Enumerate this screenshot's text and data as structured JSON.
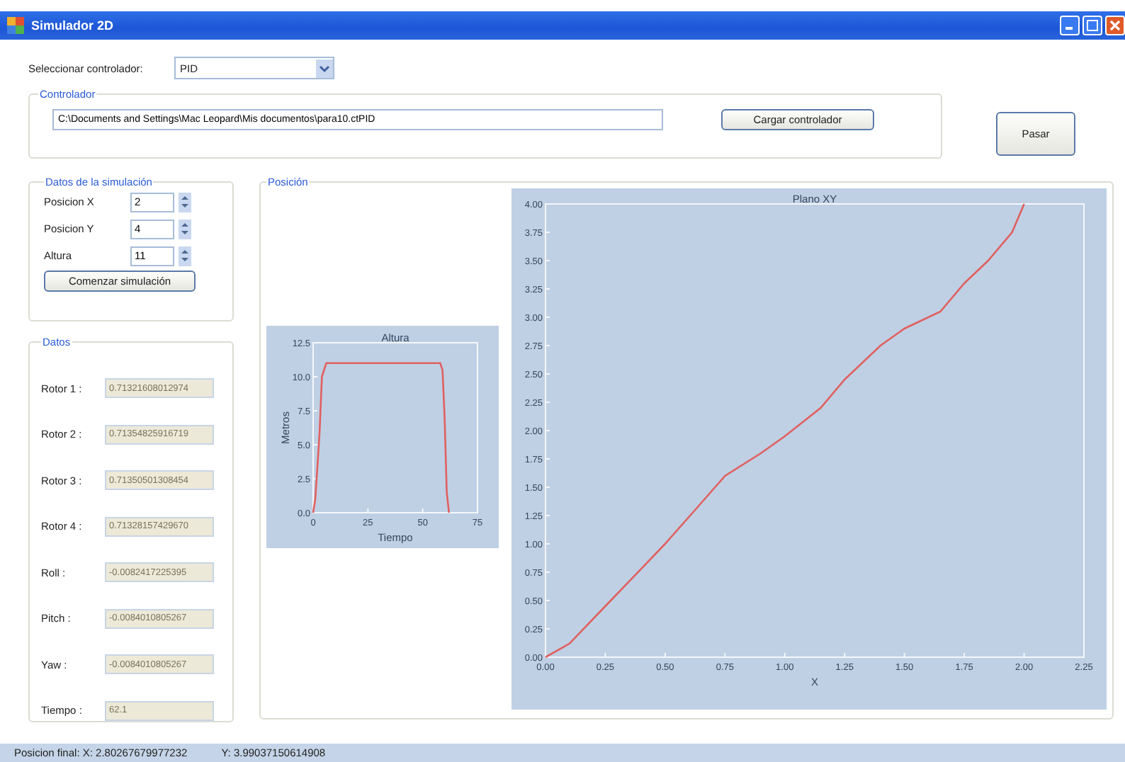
{
  "window": {
    "title": "Simulador 2D"
  },
  "controller_select": {
    "label": "Seleccionar controlador:",
    "value": "PID"
  },
  "controller_group": {
    "title": "Controlador",
    "path": "C:\\Documents and Settings\\Mac Leopard\\Mis documentos\\para10.ctPID",
    "load_button": "Cargar controlador"
  },
  "pasar_button": "Pasar",
  "simulation_group": {
    "title": "Datos de la simulación",
    "fields": [
      {
        "label": "Posicion X",
        "value": "2"
      },
      {
        "label": "Posicion Y",
        "value": "4"
      },
      {
        "label": "Altura",
        "value": "11"
      }
    ],
    "start_button": "Comenzar simulación"
  },
  "data_group": {
    "title": "Datos",
    "fields": [
      {
        "label": "Rotor 1 :",
        "value": "0.71321608012974",
        "disabled": true
      },
      {
        "label": "Rotor 2 :",
        "value": "0.71354825916719",
        "disabled": true
      },
      {
        "label": "Rotor 3 :",
        "value": "0.71350501308454",
        "disabled": true
      },
      {
        "label": "Rotor 4 :",
        "value": "0.71328157429670",
        "disabled": true
      },
      {
        "label": "Roll :",
        "value": "-0.0082417225395",
        "disabled": true
      },
      {
        "label": "Pitch :",
        "value": "-0.0084010805267",
        "disabled": true
      },
      {
        "label": "Yaw :",
        "value": "-0.0084010805267",
        "disabled": true
      },
      {
        "label": "Tiempo :",
        "value": "62.1",
        "disabled": true
      }
    ]
  },
  "position_group": {
    "title": "Posición",
    "altura_chart": {
      "chart_data": {
        "type": "line",
        "title": "Altura",
        "xlabel": "Tiempo",
        "ylabel": "Metros",
        "x": [
          0,
          1,
          2,
          3,
          4,
          5,
          6,
          7,
          8,
          58,
          59,
          60,
          61,
          62
        ],
        "series": [
          {
            "color": "#e06060",
            "values": [
              0,
              1,
              3.5,
              6,
              10,
              10.5,
              11,
              11,
              11,
              11,
              10.5,
              7,
              1.5,
              0
            ]
          }
        ],
        "xlim": [
          0,
          75
        ],
        "ylim": [
          0,
          12.5
        ],
        "xticks": [
          0,
          25,
          50,
          75
        ],
        "yticks": [
          {
            "value": 0,
            "label": "0.0"
          },
          {
            "value": 2.5,
            "label": "2.5"
          },
          {
            "value": 5,
            "label": "5.0"
          },
          {
            "value": 7.5,
            "label": "7.5"
          },
          {
            "value": 10,
            "label": "10.0"
          },
          {
            "value": 12.5,
            "label": "12.5"
          }
        ]
      }
    },
    "xy_chart": {
      "chart_data": {
        "type": "line",
        "title": "Plano XY",
        "xlabel": "X",
        "x": [
          0,
          0.1,
          0.25,
          0.4,
          0.5,
          0.625,
          0.75,
          0.9,
          1.0,
          1.15,
          1.25,
          1.4,
          1.5,
          1.65,
          1.75,
          1.85,
          1.95,
          2.0
        ],
        "series": [
          {
            "color": "#e06060",
            "values": [
              0,
              0.12,
              0.45,
              0.78,
              1.0,
              1.3,
              1.6,
              1.8,
              1.95,
              2.2,
              2.45,
              2.75,
              2.9,
              3.05,
              3.3,
              3.5,
              3.75,
              4.0
            ]
          }
        ],
        "xlim": [
          0,
          2.25
        ],
        "ylim": [
          0,
          4
        ],
        "xticks": [
          {
            "value": 0,
            "label": "0.00"
          },
          {
            "value": 0.25,
            "label": "0.25"
          },
          {
            "value": 0.5,
            "label": "0.50"
          },
          {
            "value": 0.75,
            "label": "0.75"
          },
          {
            "value": 1,
            "label": "1.00"
          },
          {
            "value": 1.25,
            "label": "1.25"
          },
          {
            "value": 1.5,
            "label": "1.50"
          },
          {
            "value": 1.75,
            "label": "1.75"
          },
          {
            "value": 2,
            "label": "2.00"
          },
          {
            "value": 2.25,
            "label": "2.25"
          }
        ],
        "yticks": [
          {
            "value": 0,
            "label": "0.00"
          },
          {
            "value": 0.25,
            "label": "0.25"
          },
          {
            "value": 0.5,
            "label": "0.50"
          },
          {
            "value": 0.75,
            "label": "0.75"
          },
          {
            "value": 1,
            "label": "1.00"
          },
          {
            "value": 1.25,
            "label": "1.25"
          },
          {
            "value": 1.5,
            "label": "1.50"
          },
          {
            "value": 1.75,
            "label": "1.75"
          },
          {
            "value": 2,
            "label": "2.00"
          },
          {
            "value": 2.25,
            "label": "2.25"
          },
          {
            "value": 2.5,
            "label": "2.50"
          },
          {
            "value": 2.75,
            "label": "2.75"
          },
          {
            "value": 3,
            "label": "3.00"
          },
          {
            "value": 3.25,
            "label": "3.25"
          },
          {
            "value": 3.5,
            "label": "3.50"
          },
          {
            "value": 3.75,
            "label": "3.75"
          },
          {
            "value": 4,
            "label": "4.00"
          }
        ]
      }
    }
  },
  "status_bar": {
    "x_text": "Posicion final: X: 2.80267679977232",
    "y_text": "Y: 3.99037150614908"
  }
}
